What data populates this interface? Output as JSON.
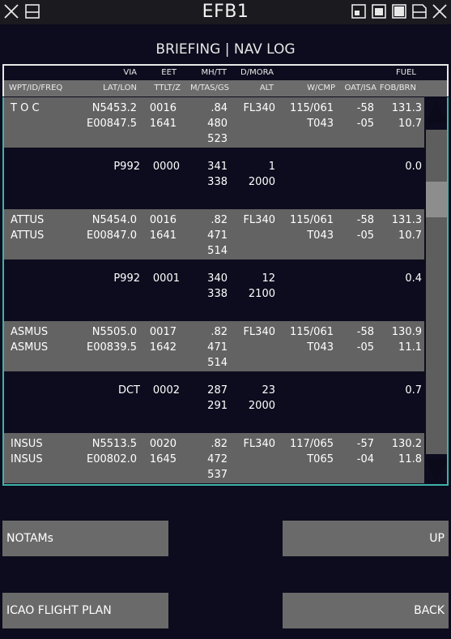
{
  "window": {
    "title": "EFB1"
  },
  "page": {
    "title": "BRIEFING | NAV LOG"
  },
  "header": {
    "top": {
      "via": "VIA",
      "eet": "EET",
      "mhtt": "MH/TT",
      "dmora": "D/MORA",
      "fuel": "FUEL"
    },
    "bottom": {
      "wpt": "WPT/ID/FREQ",
      "latlon": "LAT/LON",
      "ttlt": "TTLT/Z",
      "mtas": "M/TAS/GS",
      "alt": "ALT",
      "wcmp": "W/CMP",
      "oatisa": "OAT/ISA",
      "fobbrn": "FOB/BRN"
    }
  },
  "rows": [
    {
      "kind": "wpt",
      "wpt1": "T O C",
      "wpt2": "",
      "lat": "N5453.2",
      "lon": "E00847.5",
      "eet": "0016",
      "ttlt": "1641",
      "mach": ".84",
      "tas": "480",
      "gs": "523",
      "alt": "FL340",
      "wind": "115/061",
      "cmp": "T043",
      "oat": "-58",
      "isa": "-05",
      "fob": "131.3",
      "brn": "10.7"
    },
    {
      "kind": "leg",
      "via": "P992",
      "eet": "0000",
      "mh": "341",
      "tt": "338",
      "d": "1",
      "mora": "2000",
      "fuel": "0.0"
    },
    {
      "kind": "wpt",
      "wpt1": "ATTUS",
      "wpt2": "ATTUS",
      "lat": "N5454.0",
      "lon": "E00847.0",
      "eet": "0016",
      "ttlt": "1641",
      "mach": ".82",
      "tas": "471",
      "gs": "514",
      "alt": "FL340",
      "wind": "115/061",
      "cmp": "T043",
      "oat": "-58",
      "isa": "-05",
      "fob": "131.3",
      "brn": "10.7"
    },
    {
      "kind": "leg",
      "via": "P992",
      "eet": "0001",
      "mh": "340",
      "tt": "338",
      "d": "12",
      "mora": "2100",
      "fuel": "0.4"
    },
    {
      "kind": "wpt",
      "wpt1": "ASMUS",
      "wpt2": "ASMUS",
      "lat": "N5505.0",
      "lon": "E00839.5",
      "eet": "0017",
      "ttlt": "1642",
      "mach": ".82",
      "tas": "471",
      "gs": "514",
      "alt": "FL340",
      "wind": "115/061",
      "cmp": "T043",
      "oat": "-58",
      "isa": "-05",
      "fob": "130.9",
      "brn": "11.1"
    },
    {
      "kind": "leg",
      "via": "DCT",
      "eet": "0002",
      "mh": "287",
      "tt": "291",
      "d": "23",
      "mora": "2000",
      "fuel": "0.7"
    },
    {
      "kind": "wpt",
      "wpt1": "INSUS",
      "wpt2": "INSUS",
      "lat": "N5513.5",
      "lon": "E00802.0",
      "eet": "0020",
      "ttlt": "1645",
      "mach": ".82",
      "tas": "472",
      "gs": "537",
      "alt": "FL340",
      "wind": "117/065",
      "cmp": "T065",
      "oat": "-57",
      "isa": "-04",
      "fob": "130.2",
      "brn": "11.8"
    }
  ],
  "buttons": {
    "notams": "NOTAMs",
    "up": "UP",
    "icao": "ICAO FLIGHT PLAN",
    "back": "BACK"
  },
  "icons": {
    "titlebar_left": [
      "close-icon",
      "window-minimize-icon"
    ],
    "titlebar_right": [
      "layout-small-icon",
      "layout-medium-icon",
      "layout-large-icon",
      "window-minimize-icon",
      "close-icon"
    ],
    "scrollbar": [
      "arrow-up-icon",
      "arrow-down-icon"
    ]
  },
  "colors": {
    "background": "#0c0c1e",
    "row_waypoint": "#636363",
    "frame_border": "#3fb2a8",
    "button": "#6a6a6a"
  }
}
